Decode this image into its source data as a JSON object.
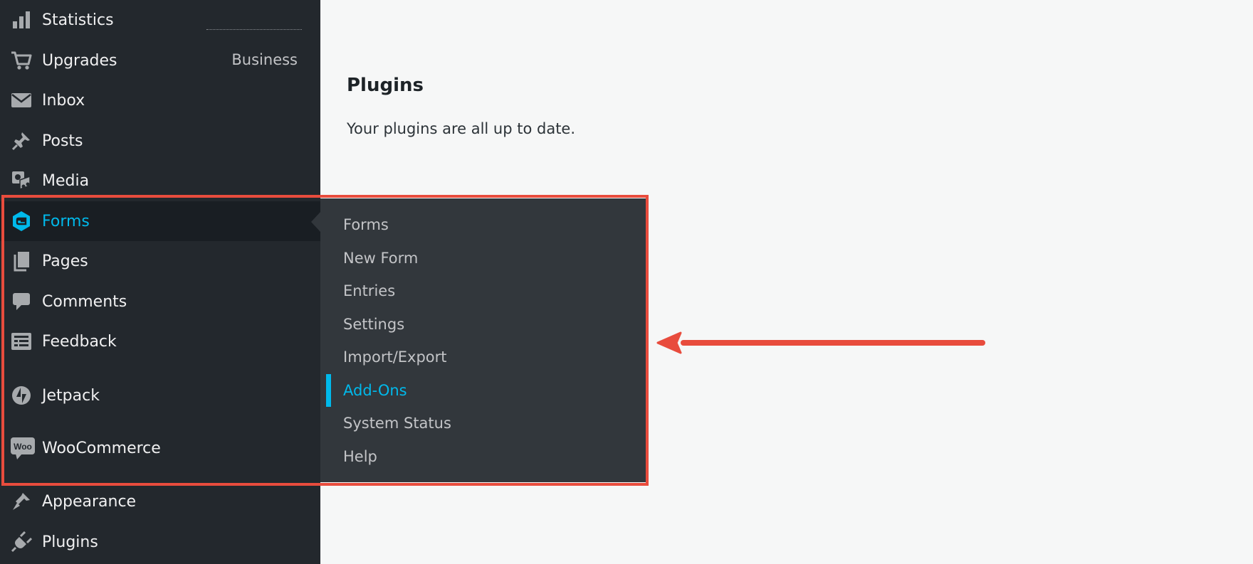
{
  "sidebar": {
    "items": [
      {
        "label": "Statistics",
        "icon": "bar-chart-icon"
      },
      {
        "label": "Upgrades",
        "icon": "cart-icon"
      },
      {
        "label": "Inbox",
        "icon": "envelope-icon"
      },
      {
        "label": "Posts",
        "icon": "pushpin-icon"
      },
      {
        "label": "Media",
        "icon": "media-icon"
      },
      {
        "label": "Forms",
        "icon": "gravity-forms-icon",
        "active": true
      },
      {
        "label": "Pages",
        "icon": "pages-icon"
      },
      {
        "label": "Comments",
        "icon": "speech-bubble-icon"
      },
      {
        "label": "Feedback",
        "icon": "feedback-icon"
      },
      {
        "label": "Jetpack",
        "icon": "jetpack-icon"
      },
      {
        "label": "WooCommerce",
        "icon": "woocommerce-icon"
      },
      {
        "label": "Appearance",
        "icon": "paintbrush-icon"
      },
      {
        "label": "Plugins",
        "icon": "plug-icon"
      }
    ],
    "plan_label": "Business",
    "woo_badge": "Woo"
  },
  "submenu": {
    "items": [
      {
        "label": "Forms"
      },
      {
        "label": "New Form"
      },
      {
        "label": "Entries"
      },
      {
        "label": "Settings"
      },
      {
        "label": "Import/Export"
      },
      {
        "label": "Add-Ons",
        "current": true
      },
      {
        "label": "System Status"
      },
      {
        "label": "Help"
      }
    ]
  },
  "content": {
    "title": "Plugins",
    "message": "Your plugins are all up to date."
  },
  "colors": {
    "sidebar_bg": "#23282d",
    "submenu_bg": "#32373c",
    "accent": "#00b9eb",
    "highlight": "#e84c3d",
    "page_bg": "#f6f7f7"
  }
}
